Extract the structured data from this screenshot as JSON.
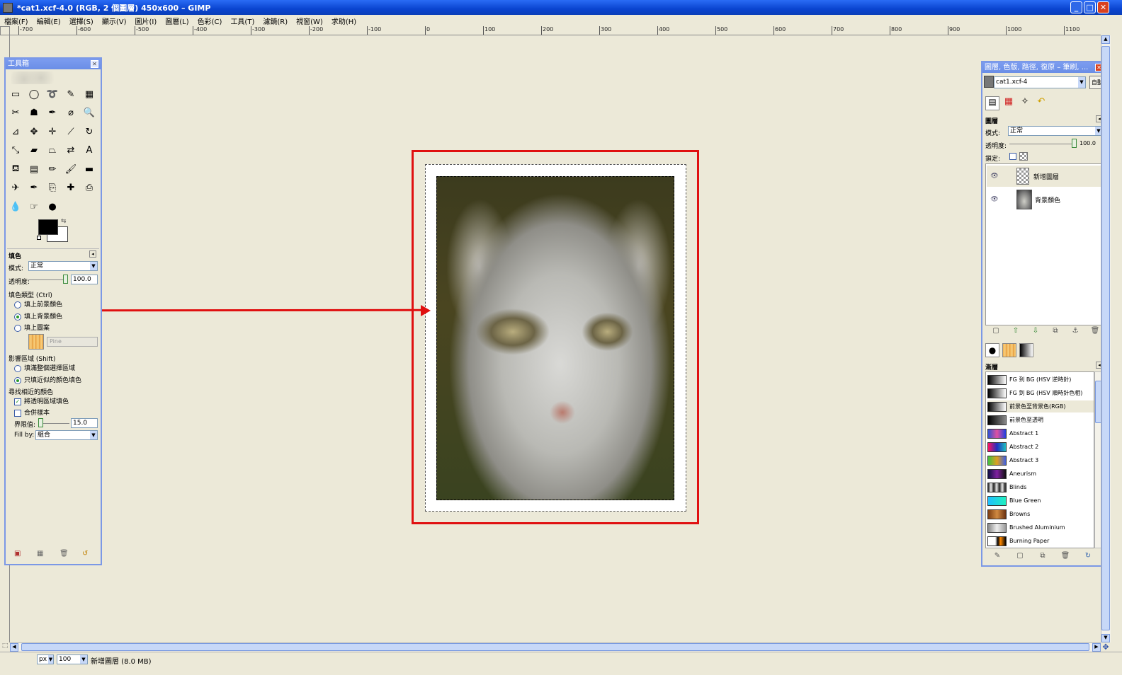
{
  "window": {
    "title": "*cat1.xcf-4.0 (RGB, 2 個圖層) 450x600 – GIMP",
    "min": "_",
    "max": "□",
    "close": "✕"
  },
  "menu": [
    "檔案(F)",
    "編輯(E)",
    "選擇(S)",
    "顯示(V)",
    "圖片(I)",
    "圖層(L)",
    "色彩(C)",
    "工具(T)",
    "濾鏡(R)",
    "視窗(W)",
    "求助(H)"
  ],
  "ruler": {
    "labels": [
      "-700",
      "-600",
      "-500",
      "-400",
      "-300",
      "-200",
      "-100",
      "0",
      "100",
      "200",
      "300",
      "400",
      "500",
      "600",
      "700",
      "800",
      "900",
      "1000",
      "1100"
    ]
  },
  "toolbox": {
    "title": "工具箱",
    "tools": [
      [
        "rect-select",
        "ellipse-select",
        "free-select",
        "fuzzy-select",
        "select-by-color"
      ],
      [
        "scissors",
        "foreground-select",
        "paths",
        "color-picker",
        "zoom"
      ],
      [
        "measure",
        "move",
        "align",
        "crop",
        "rotate"
      ],
      [
        "scale",
        "shear",
        "perspective",
        "flip",
        "text"
      ],
      [
        "bucket-fill",
        "blend",
        "pencil",
        "paintbrush",
        "eraser"
      ],
      [
        "airbrush",
        "ink",
        "clone",
        "heal",
        "perspective-clone"
      ],
      [
        "blur",
        "smudge",
        "dodge-burn"
      ]
    ],
    "tool_glyphs": {
      "rect-select": "▭",
      "ellipse-select": "◯",
      "free-select": "➰",
      "fuzzy-select": "✎",
      "select-by-color": "▦",
      "scissors": "✂",
      "foreground-select": "☗",
      "paths": "✒",
      "color-picker": "⌀",
      "zoom": "🔍",
      "measure": "⊿",
      "move": "✥",
      "align": "✛",
      "crop": "⟋",
      "rotate": "↻",
      "scale": "⤡",
      "shear": "▰",
      "perspective": "⏢",
      "flip": "⇄",
      "text": "A",
      "bucket-fill": "⛾",
      "blend": "▤",
      "pencil": "✏",
      "paintbrush": "🖌",
      "eraser": "▬",
      "airbrush": "✈",
      "ink": "✒",
      "clone": "⎘",
      "heal": "✚",
      "perspective-clone": "⎙",
      "blur": "💧",
      "smudge": "☞",
      "dodge-burn": "●"
    },
    "section_title": "填色",
    "mode_label": "模式:",
    "mode_value": "正常",
    "opacity_label": "透明度:",
    "opacity_value": "100.0",
    "fill_type_label": "填色類型 (Ctrl)",
    "fill_fg": "填上前景顏色",
    "fill_bg": "填上背景顏色",
    "fill_pattern": "填上圖案",
    "pattern_name": "Pine",
    "affected_label": "影響區域 (Shift)",
    "affected_whole": "填滿整個選擇區域",
    "affected_similar": "只填近似的顏色填色",
    "finding_label": "尋找相近的顏色",
    "fill_transparent": "將透明區域填色",
    "sample_merged": "合併樣本",
    "threshold_label": "界限值:",
    "threshold_value": "15.0",
    "fillby_label": "Fill by:",
    "fillby_value": "組合"
  },
  "status": {
    "unit": "px",
    "zoom": "100",
    "message": "新增圖層 (8.0 MB)"
  },
  "dock": {
    "title": "圖層, 色版, 路徑, 復原 – 筆刷, ...",
    "image_name": "cat1.xcf-4",
    "auto_label": "自動",
    "layers_title": "圖層",
    "mode_label": "模式:",
    "mode_value": "正常",
    "opacity_label": "透明度:",
    "opacity_value": "100.0",
    "lock_label": "鎖定:",
    "layers": [
      {
        "name": "新增圖層",
        "visible": true
      },
      {
        "name": "背景顏色",
        "visible": true
      }
    ],
    "gradients_title": "漸層",
    "gradients": [
      {
        "name": "FG 到 BG (HSV 逆時針)",
        "css": "linear-gradient(90deg,#000,#fff)"
      },
      {
        "name": "FG 到 BG (HSV 順時針色相)",
        "css": "linear-gradient(90deg,#000,#fff)"
      },
      {
        "name": "前景色至背景色(RGB)",
        "css": "linear-gradient(90deg,#000,#fff)"
      },
      {
        "name": "前景色至透明",
        "css": "linear-gradient(90deg,#000,#888)"
      },
      {
        "name": "Abstract 1",
        "css": "linear-gradient(90deg,#3050d0,#e050a0,#2040e0)"
      },
      {
        "name": "Abstract 2",
        "css": "linear-gradient(90deg,#ff1060,#2030c0,#20c0c0)"
      },
      {
        "name": "Abstract 3",
        "css": "linear-gradient(90deg,#40c040,#e0a020,#4060e0)"
      },
      {
        "name": "Aneurism",
        "css": "linear-gradient(90deg,#101040,#8020a0,#101010)"
      },
      {
        "name": "Blinds",
        "css": "repeating-linear-gradient(90deg,#222 0,#eee 4px,#222 8px)"
      },
      {
        "name": "Blue Green",
        "css": "linear-gradient(90deg,#20c0ff,#20f0c0)"
      },
      {
        "name": "Browns",
        "css": "linear-gradient(90deg,#7a3c10,#d08a40,#6a3010)"
      },
      {
        "name": "Brushed Aluminium",
        "css": "linear-gradient(90deg,#888,#eee,#999)"
      },
      {
        "name": "Burning Paper",
        "css": "linear-gradient(90deg,#fff,#fff 40%,#000 55%,#f80 70%,#000)"
      }
    ]
  },
  "colors": {
    "annotation_red": "#e01010",
    "xp_blue": "#0a44d0",
    "panel_border": "#7b98e6"
  }
}
